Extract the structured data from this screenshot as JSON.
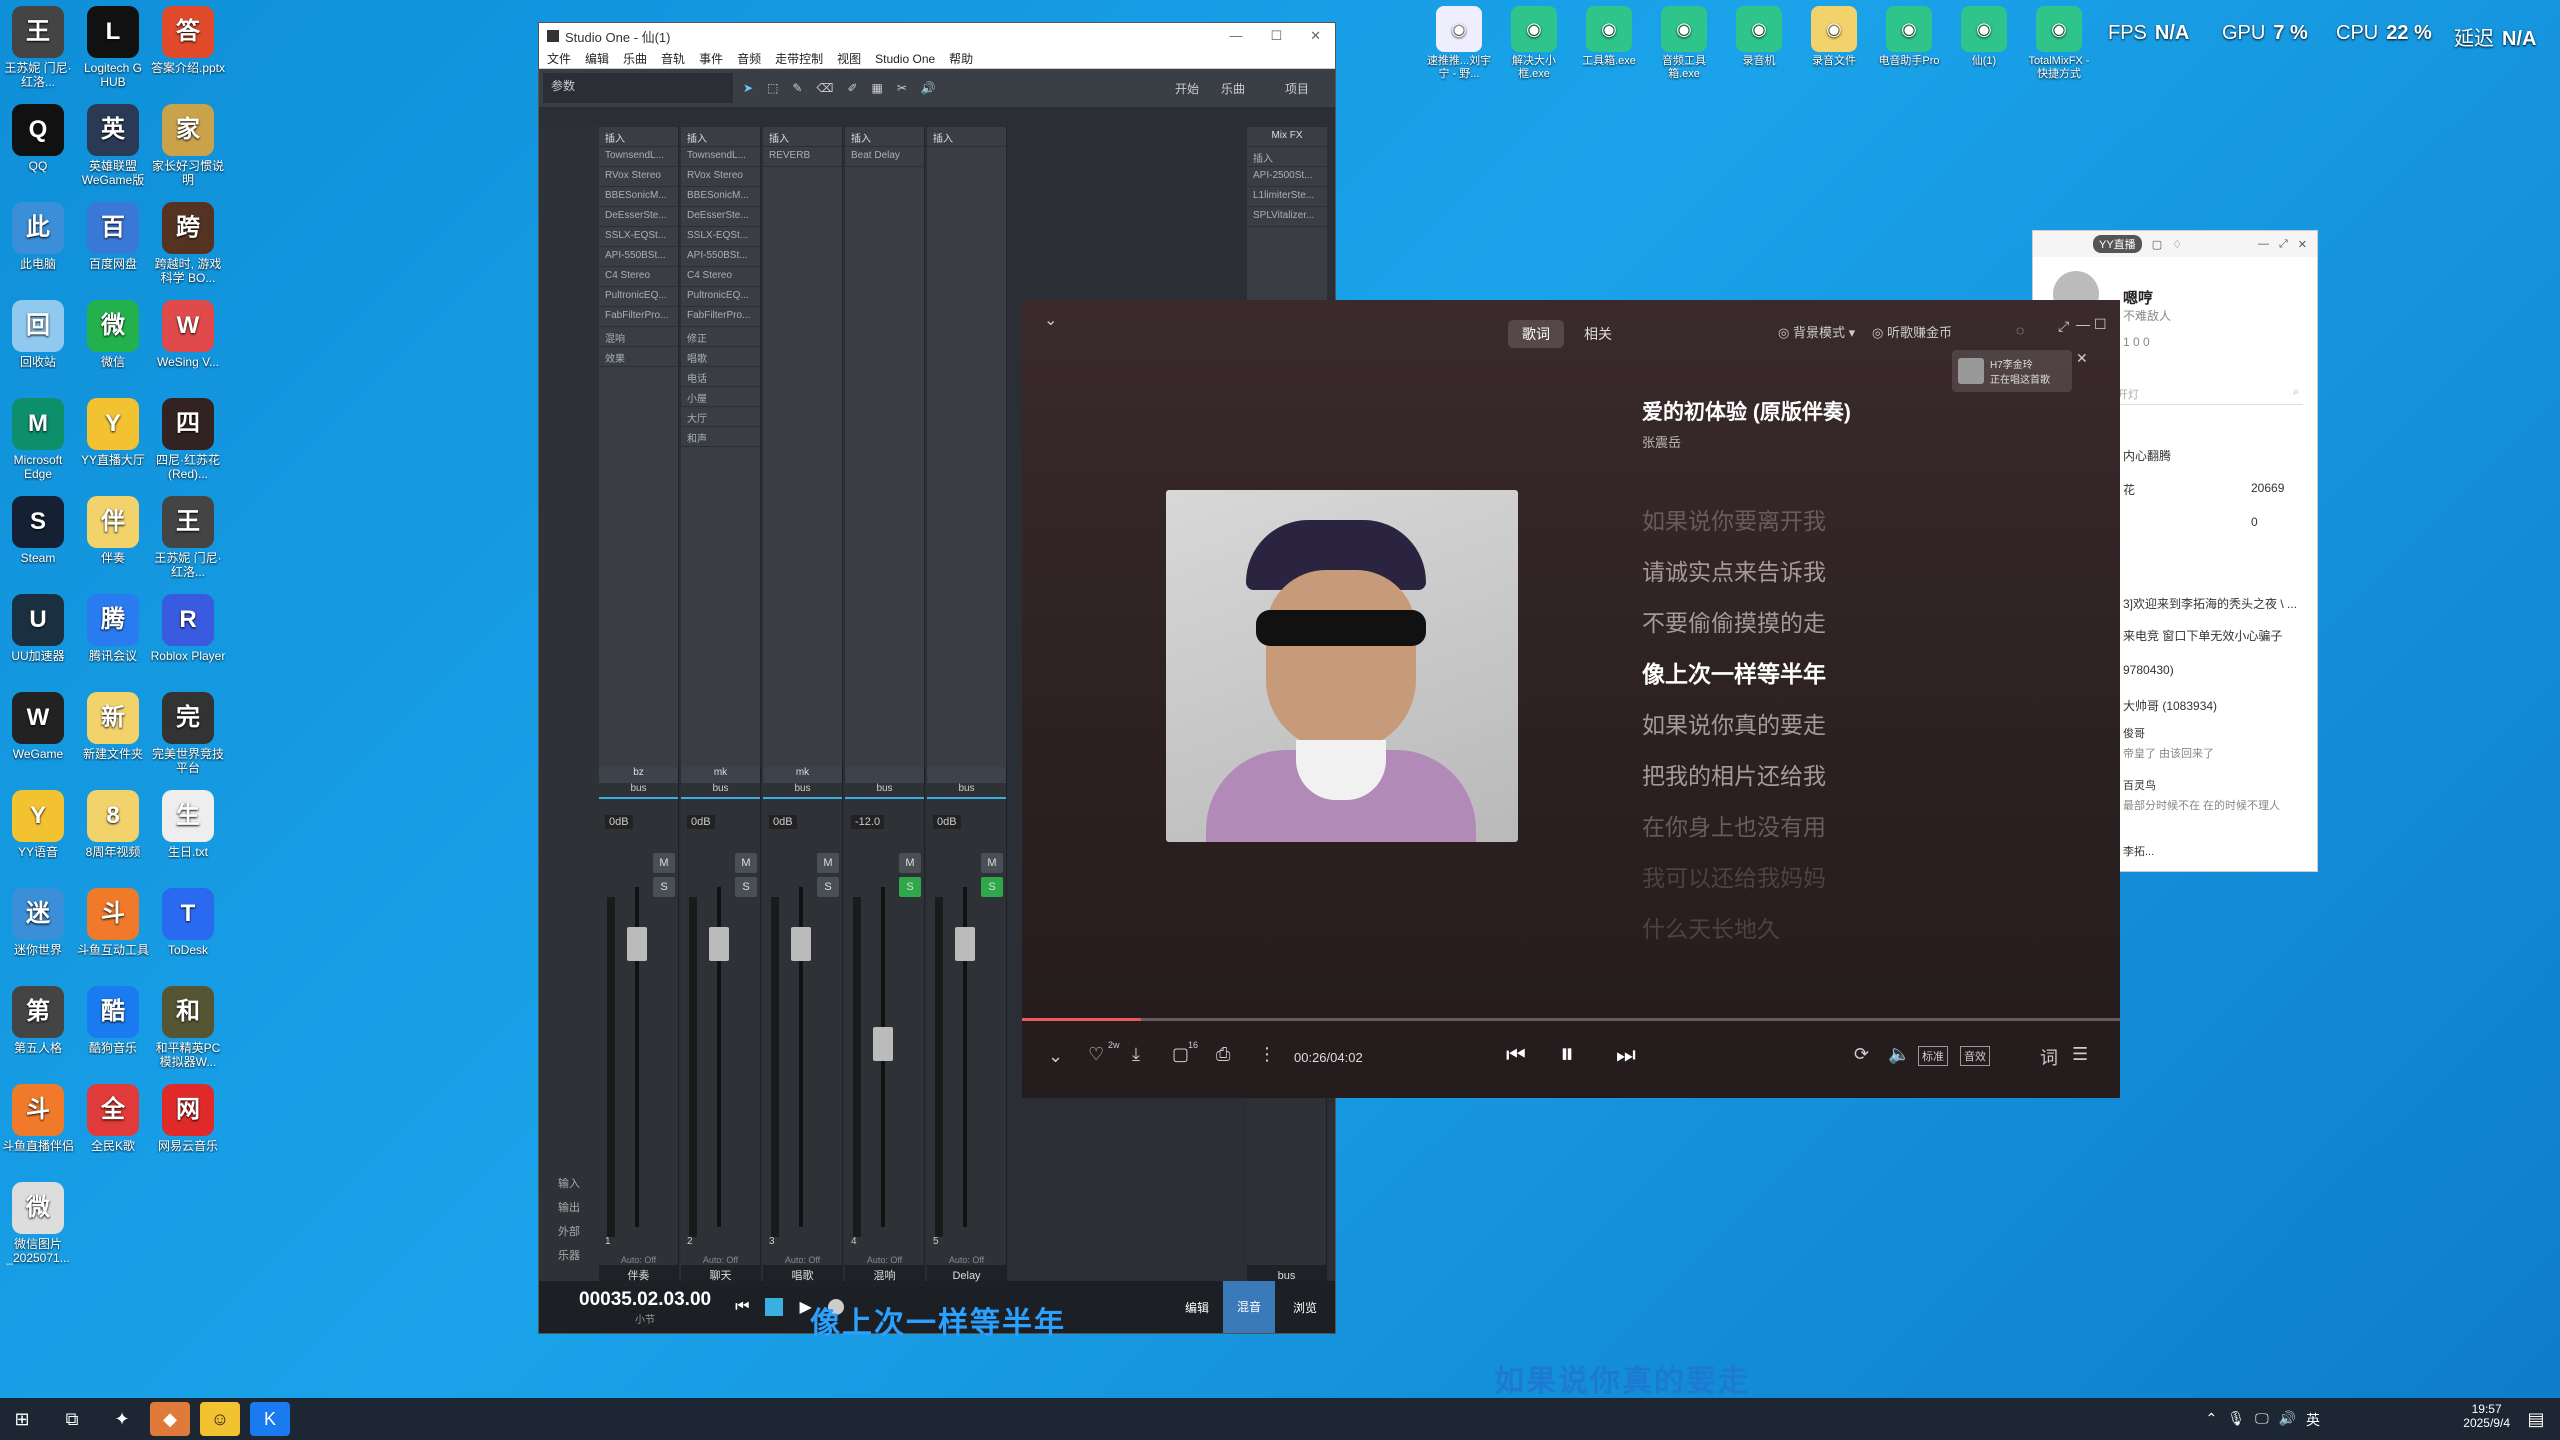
{
  "desktop": {
    "icons": [
      {
        "label": "王苏妮 门尼·红洛...",
        "icon": "game-icon",
        "color": "#444"
      },
      {
        "label": "Logitech G HUB",
        "icon": "logitech-icon",
        "color": "#111"
      },
      {
        "label": "答案介绍.pptx",
        "icon": "pptx-icon",
        "color": "#e04a2a"
      },
      {
        "label": "QQ",
        "icon": "qq-icon",
        "color": "#111"
      },
      {
        "label": "英雄联盟WeGame版",
        "icon": "lol-icon",
        "color": "#2a3a55"
      },
      {
        "label": "家长好习惯说明",
        "icon": "zip-icon",
        "color": "#c9a24a"
      },
      {
        "label": "此电脑",
        "icon": "computer-icon",
        "color": "#3a8fd8"
      },
      {
        "label": "百度网盘",
        "icon": "baidu-icon",
        "color": "#3a78d8"
      },
      {
        "label": "跨越时, 游戏科学 BO...",
        "icon": "game-icon",
        "color": "#553322"
      },
      {
        "label": "回收站",
        "icon": "recycle-icon",
        "color": "#8fc9f0"
      },
      {
        "label": "微信",
        "icon": "wechat-icon",
        "color": "#22b14c"
      },
      {
        "label": "WeSing V...",
        "icon": "wesing-icon",
        "color": "#e04a4a"
      },
      {
        "label": "Microsoft Edge",
        "icon": "edge-icon",
        "color": "#0c8f6a"
      },
      {
        "label": "YY直播大厅",
        "icon": "yy-icon",
        "color": "#f2c230"
      },
      {
        "label": "四尼·红苏花 (Red)...",
        "icon": "game-icon",
        "color": "#332222"
      },
      {
        "label": "Steam",
        "icon": "steam-icon",
        "color": "#152035"
      },
      {
        "label": "伴奏",
        "icon": "folder-icon",
        "color": "#f2d26a"
      },
      {
        "label": "王苏妮 门尼·红洛...",
        "icon": "game-icon",
        "color": "#444"
      },
      {
        "label": "UU加速器",
        "icon": "uu-icon",
        "color": "#1a3040"
      },
      {
        "label": "腾讯会议",
        "icon": "meeting-icon",
        "color": "#2a7af0"
      },
      {
        "label": "Roblox Player",
        "icon": "roblox-icon",
        "color": "#3a5ae0"
      },
      {
        "label": "WeGame",
        "icon": "wegame-icon",
        "color": "#222"
      },
      {
        "label": "新建文件夹",
        "icon": "folder-icon",
        "color": "#f2d26a"
      },
      {
        "label": "完美世界竞技平台",
        "icon": "perfect-icon",
        "color": "#333"
      },
      {
        "label": "YY语音",
        "icon": "yy-icon",
        "color": "#f2c230"
      },
      {
        "label": "8周年视频",
        "icon": "folder-icon",
        "color": "#f2d26a"
      },
      {
        "label": "生日.txt",
        "icon": "txt-icon",
        "color": "#eee"
      },
      {
        "label": "迷你世界",
        "icon": "mini-icon",
        "color": "#3a8fd8"
      },
      {
        "label": "斗鱼互动工具",
        "icon": "douyu-icon",
        "color": "#f07a2a"
      },
      {
        "label": "ToDesk",
        "icon": "todesk-icon",
        "color": "#2a6af0"
      },
      {
        "label": "第五人格",
        "icon": "game-icon",
        "color": "#444"
      },
      {
        "label": "酷狗音乐",
        "icon": "kugou-icon",
        "color": "#1a7af0"
      },
      {
        "label": "和平精英PC模拟器W...",
        "icon": "game-icon",
        "color": "#553"
      },
      {
        "label": "斗鱼直播伴侣",
        "icon": "douyu-icon",
        "color": "#f07a2a"
      },
      {
        "label": "全民K歌",
        "icon": "kge-icon",
        "color": "#e03a3a"
      },
      {
        "label": "网易云音乐",
        "icon": "netease-icon",
        "color": "#e02a2a"
      },
      {
        "label": "微信图片_2025071...",
        "icon": "image-icon",
        "color": "#ddd"
      }
    ],
    "top_icons": [
      {
        "label": "速推推...刘宇宁 - 野...",
        "icon": "mp3-icon"
      },
      {
        "label": "解决大小框.exe",
        "icon": "exe-icon"
      },
      {
        "label": "工具箱.exe",
        "icon": "exe-icon"
      },
      {
        "label": "音频工具箱.exe",
        "icon": "exe-icon"
      },
      {
        "label": "录音机",
        "icon": "recorder-icon"
      },
      {
        "label": "录音文件",
        "icon": "folder-icon"
      },
      {
        "label": "电音助手Pro",
        "icon": "cd-icon"
      },
      {
        "label": "仙(1)",
        "icon": "app-icon"
      },
      {
        "label": "TotalMixFX - 快捷方式",
        "icon": "totalmix-icon"
      }
    ],
    "stats": {
      "fps_label": "FPS",
      "fps_value": "N/A",
      "gpu_label": "GPU",
      "gpu_value": "7 %",
      "cpu_label": "CPU",
      "cpu_value": "22 %",
      "latency_label": "延迟",
      "latency_value": "N/A"
    },
    "overlay_lyric_1": "像上次一样等半年",
    "overlay_lyric_2": "如果说你真的要走"
  },
  "studio_one": {
    "title": "Studio One - 仙(1)",
    "menu": [
      "文件",
      "编辑",
      "乐曲",
      "音轨",
      "事件",
      "音频",
      "走带控制",
      "视图",
      "Studio One",
      "帮助"
    ],
    "toolbar": {
      "params": "参数",
      "start": "开始",
      "song": "乐曲",
      "project": "项目"
    },
    "insert_label": "插入",
    "channels": [
      {
        "name": "伴奏",
        "route": "bus",
        "slots": [
          "TownsendL...",
          "RVox Stereo",
          "BBESonicM...",
          "DeEsserSte...",
          "SSLX-EQSt...",
          "API-550BSt...",
          "C4 Stereo",
          "PultronicEQ...",
          "FabFilterPro...",
          "混响",
          "效果"
        ],
        "num": "1",
        "db": "0dB",
        "head": "bz"
      },
      {
        "name": "聊天",
        "route": "bus",
        "slots": [
          "TownsendL...",
          "RVox Stereo",
          "BBESonicM...",
          "DeEsserSte...",
          "SSLX-EQSt...",
          "API-550BSt...",
          "C4 Stereo",
          "PultronicEQ...",
          "FabFilterPro...",
          "修正",
          "唱歌",
          "电话",
          "小屋",
          "大厅",
          "和声"
        ],
        "num": "2",
        "db": "0dB",
        "head": "mk"
      },
      {
        "name": "唱歌",
        "route": "bus",
        "slots": [
          "REVERB"
        ],
        "num": "3",
        "db": "0dB",
        "head": "mk"
      },
      {
        "name": "混响",
        "route": "bus",
        "slots": [
          "Beat Delay"
        ],
        "num": "4",
        "db": "-12.0",
        "head": ""
      },
      {
        "name": "Delay",
        "route": "bus",
        "slots": [],
        "num": "5",
        "db": "0dB",
        "head": ""
      }
    ],
    "mixfx": {
      "label": "Mix FX",
      "insert": "插入",
      "slots": [
        "API-2500St...",
        "L1limiterSte...",
        "SPLVitalizer..."
      ],
      "name": "bus"
    },
    "side_labels": [
      "输入",
      "输出",
      "外部",
      "乐器"
    ],
    "auto_off": "Auto: Off",
    "btn_m": "M",
    "btn_s": "S",
    "transport": {
      "time": "00035.02.03.00",
      "unit": "小节",
      "edit": "编辑",
      "mix": "混音",
      "browse": "浏览"
    }
  },
  "player": {
    "tabs": [
      "歌词",
      "相关"
    ],
    "bg_mode": "背景模式",
    "earn": "听歌赚金币",
    "notify": {
      "line1": "H7李金玲",
      "line2": "正在唱这首歌"
    },
    "song_title": "爱的初体验 (原版伴奏)",
    "artist": "张震岳",
    "lyrics": [
      "如果说你要离开我",
      "请诚实点来告诉我",
      "不要偷偷摸摸的走",
      "像上次一样等半年",
      "如果说你真的要走",
      "把我的相片还给我",
      "在你身上也没有用",
      "我可以还给我妈妈",
      "什么天长地久"
    ],
    "current_index": 3,
    "progress": 0.108,
    "time": "00:26/04:02",
    "like_count": "2w",
    "comment_count": "16",
    "quality": "标准",
    "effect": "音效",
    "lyric_btn": "词"
  },
  "yy": {
    "badge": "YY直播",
    "name": "嗯哼",
    "sub": "不难敌人",
    "stats": "1  0  0",
    "search": "开灯",
    "rows": [
      "内心翻腾",
      "花",
      "20669",
      "0",
      "3]欢迎来到李拓海的秃头之夜 \\ ...",
      "来电竞 窗口下单无效小心骗子",
      "9780430)",
      "大帅哥 (1083934)",
      "俊哥",
      "帝皇了 由该回来了",
      "百灵鸟",
      "最部分时候不在 在的时候不理人",
      "李拓..."
    ]
  },
  "taskbar": {
    "time": "19:57",
    "date": "2025/9/4",
    "ime": "英"
  }
}
